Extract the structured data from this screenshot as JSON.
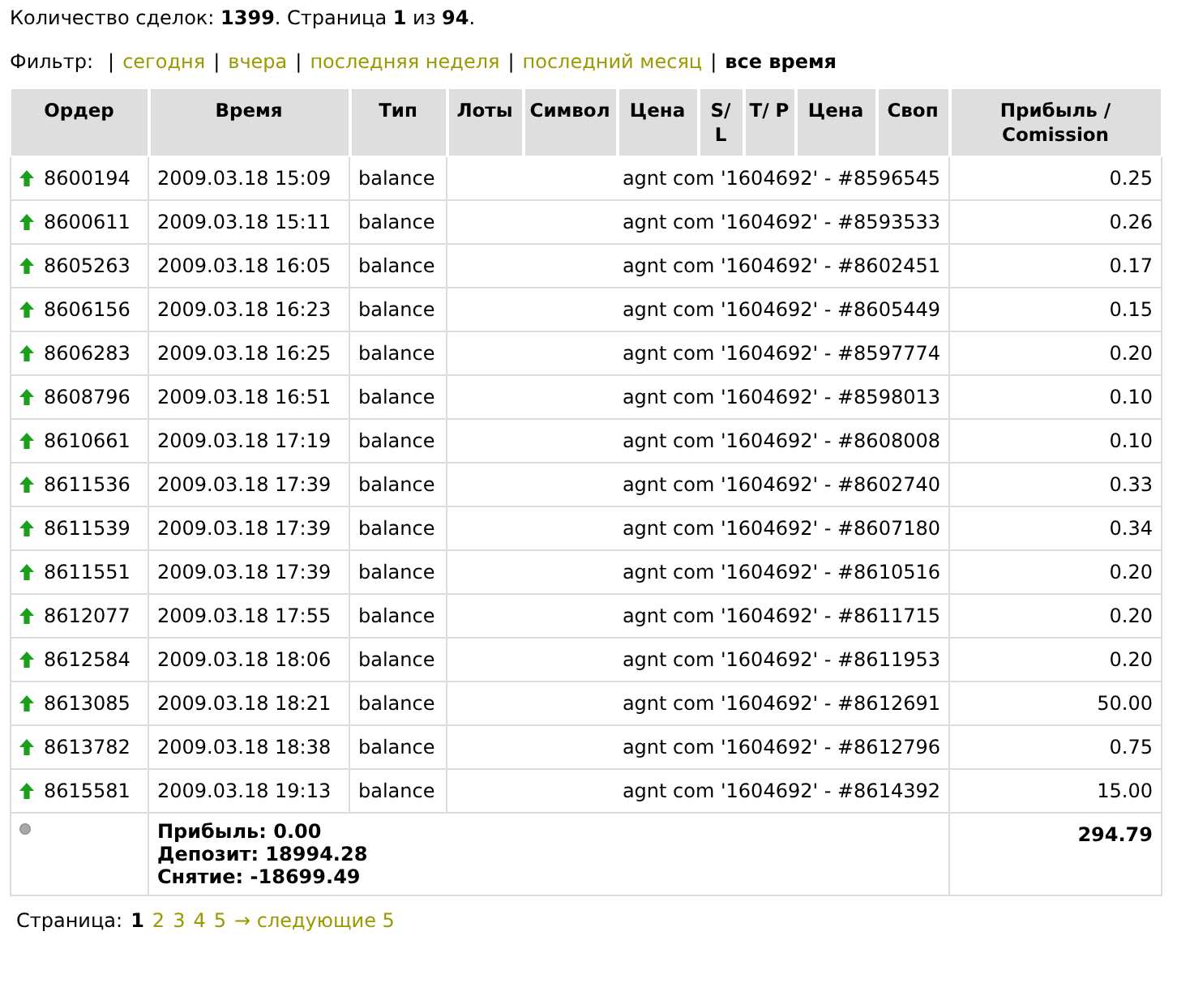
{
  "summary_line": "Количество сделок: **1399**. Страница **1** из **94**.",
  "filter": {
    "label": "Фильтр:",
    "separator": "|",
    "items": [
      {
        "label": "сегодня",
        "selected": false
      },
      {
        "label": "вчера",
        "selected": false
      },
      {
        "label": "последняя неделя",
        "selected": false
      },
      {
        "label": "последний месяц",
        "selected": false
      },
      {
        "label": "все время",
        "selected": true
      }
    ]
  },
  "table": {
    "columns": [
      "Ордер",
      "Время",
      "Тип",
      "Лоты",
      "Символ",
      "Цена",
      "S/ L",
      "T/ P",
      "Цена",
      "Своп",
      "Прибыль / Comission"
    ],
    "rows": [
      {
        "order": "8600194",
        "time": "2009.03.18 15:09",
        "type": "balance",
        "comment": "agnt com '1604692' - #8596545",
        "profit": "0.25"
      },
      {
        "order": "8600611",
        "time": "2009.03.18 15:11",
        "type": "balance",
        "comment": "agnt com '1604692' - #8593533",
        "profit": "0.26"
      },
      {
        "order": "8605263",
        "time": "2009.03.18 16:05",
        "type": "balance",
        "comment": "agnt com '1604692' - #8602451",
        "profit": "0.17"
      },
      {
        "order": "8606156",
        "time": "2009.03.18 16:23",
        "type": "balance",
        "comment": "agnt com '1604692' - #8605449",
        "profit": "0.15"
      },
      {
        "order": "8606283",
        "time": "2009.03.18 16:25",
        "type": "balance",
        "comment": "agnt com '1604692' - #8597774",
        "profit": "0.20"
      },
      {
        "order": "8608796",
        "time": "2009.03.18 16:51",
        "type": "balance",
        "comment": "agnt com '1604692' - #8598013",
        "profit": "0.10"
      },
      {
        "order": "8610661",
        "time": "2009.03.18 17:19",
        "type": "balance",
        "comment": "agnt com '1604692' - #8608008",
        "profit": "0.10"
      },
      {
        "order": "8611536",
        "time": "2009.03.18 17:39",
        "type": "balance",
        "comment": "agnt com '1604692' - #8602740",
        "profit": "0.33"
      },
      {
        "order": "8611539",
        "time": "2009.03.18 17:39",
        "type": "balance",
        "comment": "agnt com '1604692' - #8607180",
        "profit": "0.34"
      },
      {
        "order": "8611551",
        "time": "2009.03.18 17:39",
        "type": "balance",
        "comment": "agnt com '1604692' - #8610516",
        "profit": "0.20"
      },
      {
        "order": "8612077",
        "time": "2009.03.18 17:55",
        "type": "balance",
        "comment": "agnt com '1604692' - #8611715",
        "profit": "0.20"
      },
      {
        "order": "8612584",
        "time": "2009.03.18 18:06",
        "type": "balance",
        "comment": "agnt com '1604692' - #8611953",
        "profit": "0.20"
      },
      {
        "order": "8613085",
        "time": "2009.03.18 18:21",
        "type": "balance",
        "comment": "agnt com '1604692' - #8612691",
        "profit": "50.00"
      },
      {
        "order": "8613782",
        "time": "2009.03.18 18:38",
        "type": "balance",
        "comment": "agnt com '1604692' - #8612796",
        "profit": "0.75"
      },
      {
        "order": "8615581",
        "time": "2009.03.18 19:13",
        "type": "balance",
        "comment": "agnt com '1604692' - #8614392",
        "profit": "15.00"
      }
    ],
    "totals": {
      "lines": [
        "Прибыль: 0.00",
        "Депозит: 18994.28",
        "Снятие: -18699.49"
      ],
      "total": "294.79"
    }
  },
  "pagination": {
    "label": "Страница:",
    "pages": [
      {
        "label": "1",
        "selected": true
      },
      {
        "label": "2",
        "selected": false
      },
      {
        "label": "3",
        "selected": false
      },
      {
        "label": "4",
        "selected": false
      },
      {
        "label": "5",
        "selected": false
      }
    ],
    "next": "→ следующие 5"
  }
}
